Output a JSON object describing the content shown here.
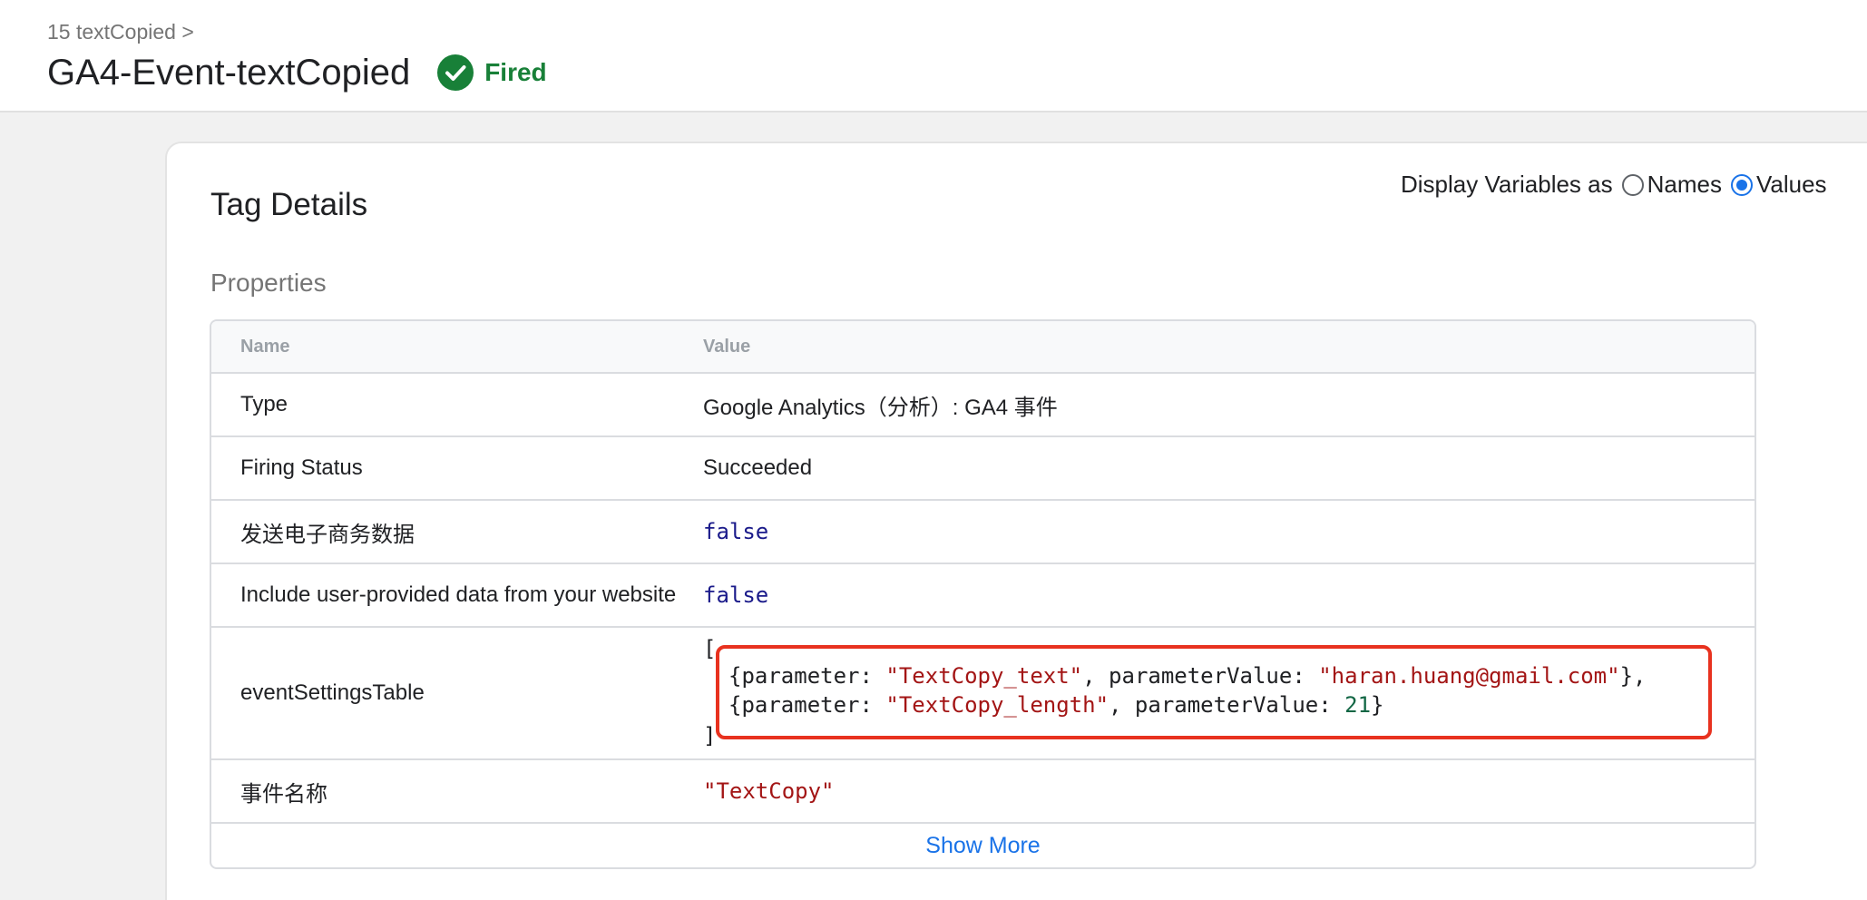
{
  "header": {
    "breadcrumb": "15 textCopied >",
    "title": "GA4-Event-textCopied",
    "status_label": "Fired",
    "status_color": "#188038",
    "status_icon": "check-circle-icon"
  },
  "card": {
    "title": "Tag Details",
    "display_vars": {
      "label": "Display Variables as",
      "options": [
        "Names",
        "Values"
      ],
      "selected": "Values"
    },
    "section_title": "Properties",
    "table": {
      "headers": {
        "name": "Name",
        "value": "Value"
      },
      "rows": {
        "type": {
          "name": "Type",
          "value": "Google Analytics（分析）: GA4 事件"
        },
        "firing_status": {
          "name": "Firing Status",
          "value": "Succeeded"
        },
        "send_ecommerce": {
          "name": "发送电子商务数据",
          "value": "false"
        },
        "user_provided": {
          "name": "Include user-provided data from your website",
          "value": "false"
        },
        "event_settings": {
          "name": "eventSettingsTable",
          "open": "[",
          "close": "]",
          "line1": {
            "prefix": "{parameter: ",
            "param": "\"TextCopy_text\"",
            "mid": ", parameterValue: ",
            "value": "\"haran.huang@gmail.com\"",
            "suffix": "},"
          },
          "line2": {
            "prefix": "{parameter: ",
            "param": "\"TextCopy_length\"",
            "mid": ", parameterValue: ",
            "value": "21",
            "suffix": "}"
          }
        },
        "event_name": {
          "name": "事件名称",
          "value": "\"TextCopy\""
        }
      },
      "show_more": "Show More"
    }
  },
  "colors": {
    "accent": "#1a73e8",
    "highlight": "#e8321f",
    "string": "#a31515",
    "boolean": "#1a1a8a",
    "number": "#116644"
  }
}
